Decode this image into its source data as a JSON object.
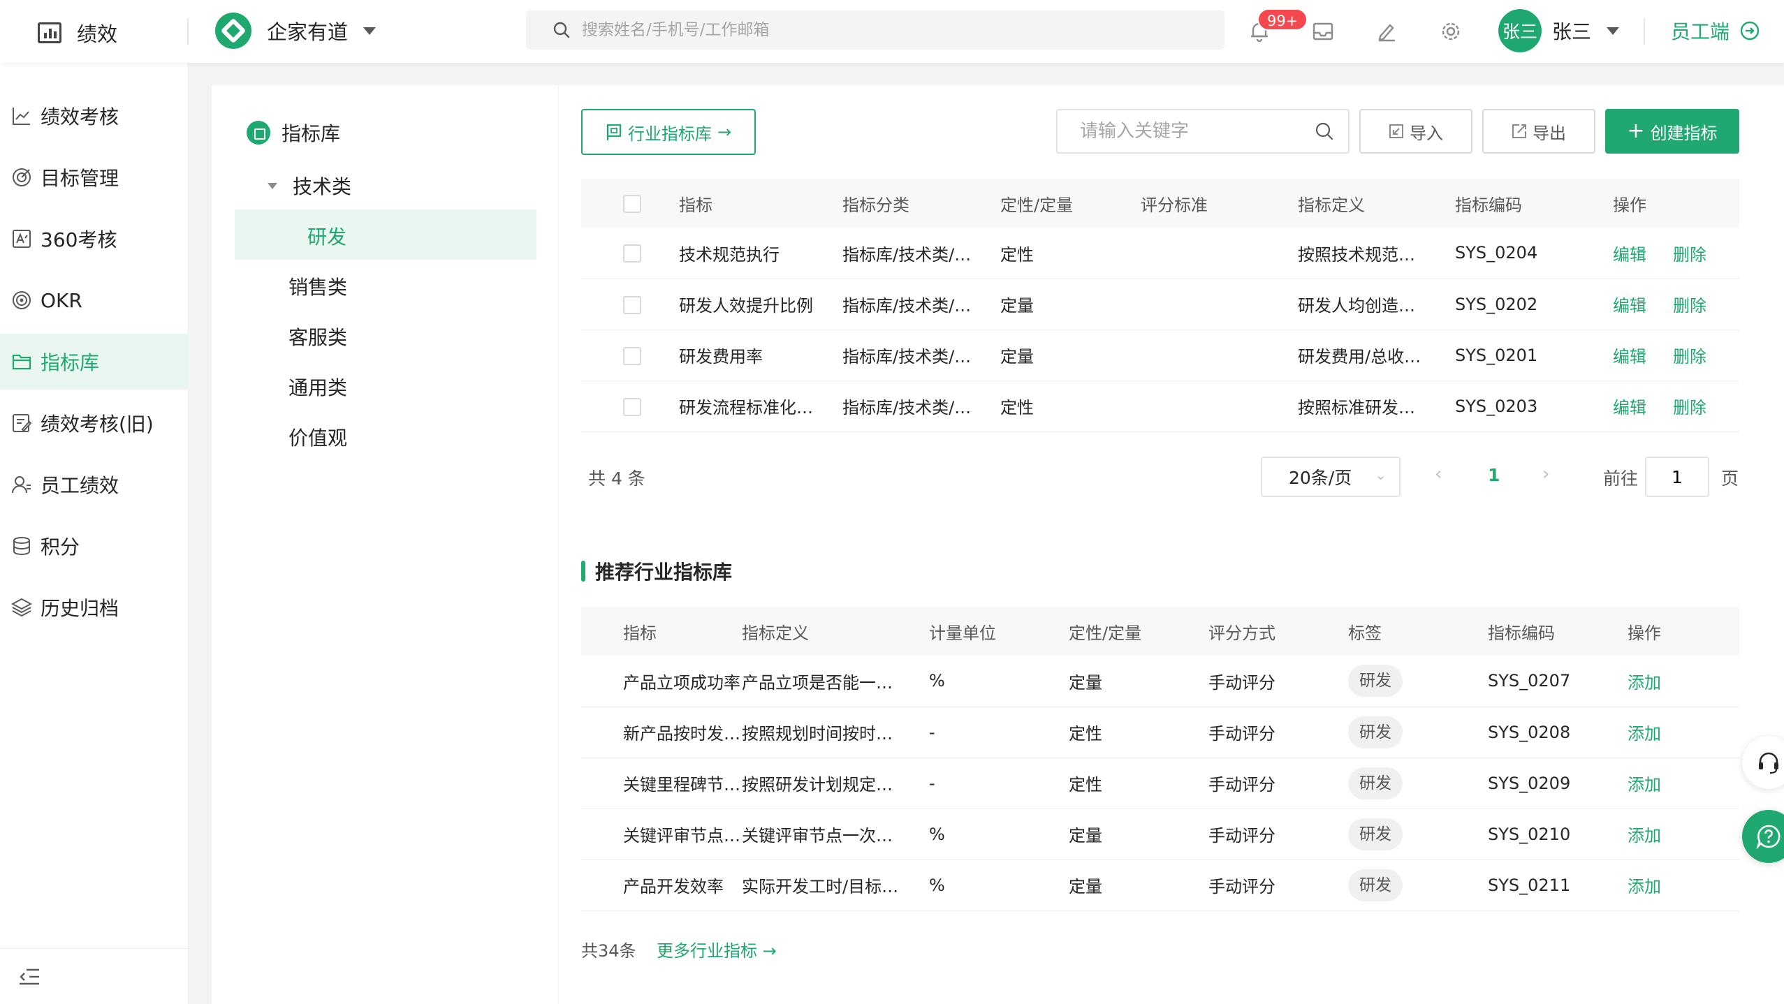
{
  "header": {
    "brand": "绩效",
    "org_name": "企家有道",
    "search_placeholder": "搜索姓名/手机号/工作邮箱",
    "notification_badge": "99+",
    "avatar_text": "张三",
    "user_name": "张三",
    "staff_link": "员工端",
    "icons": [
      "bell-icon",
      "inbox-icon",
      "edit-icon",
      "settings-icon"
    ]
  },
  "sidebar": {
    "items": [
      {
        "label": "绩效考核",
        "icon": "line-chart-icon"
      },
      {
        "label": "目标管理",
        "icon": "target-icon"
      },
      {
        "label": "360考核",
        "icon": "review-icon"
      },
      {
        "label": "OKR",
        "icon": "okr-icon"
      },
      {
        "label": "指标库",
        "icon": "folder-icon",
        "active": true
      },
      {
        "label": "绩效考核(旧)",
        "icon": "doc-edit-icon"
      },
      {
        "label": "员工绩效",
        "icon": "user-icon"
      },
      {
        "label": "积分",
        "icon": "coins-icon"
      },
      {
        "label": "历史归档",
        "icon": "layers-icon"
      }
    ],
    "collapse_icon": "collapse-menu-icon"
  },
  "tree": {
    "root": "指标库",
    "group": "技术类",
    "selected_child": "研发",
    "categories": [
      "销售类",
      "客服类",
      "通用类",
      "价值观"
    ]
  },
  "toolbar": {
    "industry_button": "行业指标库",
    "keyword_placeholder": "请输入关键字",
    "import_label": "导入",
    "export_label": "导出",
    "create_label": "创建指标"
  },
  "indicator_table": {
    "columns": [
      "指标",
      "指标分类",
      "定性/定量",
      "评分标准",
      "指标定义",
      "指标编码",
      "操作"
    ],
    "rows": [
      {
        "name": "技术规范执行",
        "category": "指标库/技术类/…",
        "type": "定性",
        "standard": "",
        "definition": "按照技术规范…",
        "code": "SYS_0204"
      },
      {
        "name": "研发人效提升比例",
        "category": "指标库/技术类/…",
        "type": "定量",
        "standard": "",
        "definition": "研发人均创造…",
        "code": "SYS_0202"
      },
      {
        "name": "研发费用率",
        "category": "指标库/技术类/…",
        "type": "定量",
        "standard": "",
        "definition": "研发费用/总收…",
        "code": "SYS_0201"
      },
      {
        "name": "研发流程标准化…",
        "category": "指标库/技术类/…",
        "type": "定性",
        "standard": "",
        "definition": "按照标准研发…",
        "code": "SYS_0203"
      }
    ],
    "edit_label": "编辑",
    "delete_label": "删除"
  },
  "pagination": {
    "total_text": "共 4 条",
    "page_size": "20条/页",
    "current_page": "1",
    "goto_label": "前往",
    "goto_value": "1",
    "page_suffix": "页"
  },
  "recommend": {
    "title": "推荐行业指标库",
    "columns": [
      "指标",
      "指标定义",
      "计量单位",
      "定性/定量",
      "评分方式",
      "标签",
      "指标编码",
      "操作"
    ],
    "rows": [
      {
        "name": "产品立项成功率",
        "definition": "产品立项是否能一…",
        "unit": "%",
        "type": "定量",
        "method": "手动评分",
        "tag": "研发",
        "code": "SYS_0207"
      },
      {
        "name": "新产品按时发…",
        "definition": "按照规划时间按时…",
        "unit": "-",
        "type": "定性",
        "method": "手动评分",
        "tag": "研发",
        "code": "SYS_0208"
      },
      {
        "name": "关键里程碑节…",
        "definition": "按照研发计划规定…",
        "unit": "-",
        "type": "定性",
        "method": "手动评分",
        "tag": "研发",
        "code": "SYS_0209"
      },
      {
        "name": "关键评审节点…",
        "definition": "关键评审节点一次…",
        "unit": "%",
        "type": "定量",
        "method": "手动评分",
        "tag": "研发",
        "code": "SYS_0210"
      },
      {
        "name": "产品开发效率",
        "definition": "实际开发工时/目标…",
        "unit": "%",
        "type": "定量",
        "method": "手动评分",
        "tag": "研发",
        "code": "SYS_0211"
      }
    ],
    "add_label": "添加",
    "total_text": "共34条",
    "more_link": "更多行业指标"
  },
  "colors": {
    "accent": "#1fa86f",
    "badge": "#f5484f",
    "active_bg": "#eaf7f1"
  }
}
